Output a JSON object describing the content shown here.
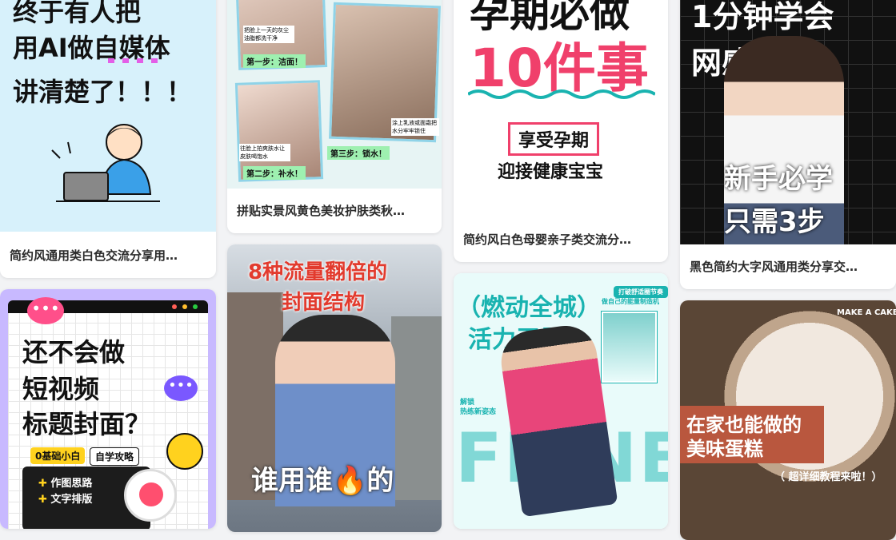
{
  "cards": [
    {
      "caption": "简约风通用类白色交流分享用…",
      "title_lines": [
        "终于有人把",
        "用AI做自媒体",
        "讲清楚了！！！"
      ]
    },
    {
      "caption": "拼贴实景风黄色美妆护肤类秋…",
      "steps": [
        "第一步：洁面！",
        "第二步：补水！",
        "第三步：锁水！"
      ],
      "notes": [
        "把脸上一天的灰尘油脂都洗干净",
        "往脸上拍爽肤水让皮肤喝饱水",
        "涂上乳液或面霜把水分牢牢锁住"
      ]
    },
    {
      "caption": "简约风白色母婴亲子类交流分…",
      "title_lines": [
        "孕期必做",
        "10件事"
      ],
      "subtitle_lines": [
        "享受孕期",
        "迎接健康宝宝"
      ]
    },
    {
      "caption": "黑色简约大字风通用类分享交…",
      "title_lines": [
        "1分钟学会",
        "网感封面"
      ],
      "bottom_lines": [
        "新手必学",
        "只需3步"
      ]
    },
    {
      "title_lines": [
        "还不会做",
        "短视频",
        "标题封面？"
      ],
      "tags": [
        "0基础小白",
        "自学攻略"
      ],
      "bullets": [
        "作图思路",
        "文字排版"
      ]
    },
    {
      "title_lines": [
        "8种流量翻倍的",
        "封面结构"
      ],
      "bottom_line": "谁用谁🔥的"
    },
    {
      "title_lines": [
        "（燃动全城）",
        "活力无界"
      ],
      "side_text": [
        "打破舒适圈节奏",
        "做自己的能量制造机"
      ],
      "unlock": [
        "解锁",
        "热练新姿态"
      ],
      "big_word": "FITNESS"
    },
    {
      "corner": "MAKE A CAKE",
      "title_lines": [
        "在家也能做的",
        "美味蛋糕"
      ],
      "footer": "（ 超详细教程来啦！）"
    }
  ],
  "colors": {
    "pink": "#f0406b",
    "teal": "#19b3b0",
    "yellow": "#ffd21e",
    "red": "#e23b2e"
  }
}
